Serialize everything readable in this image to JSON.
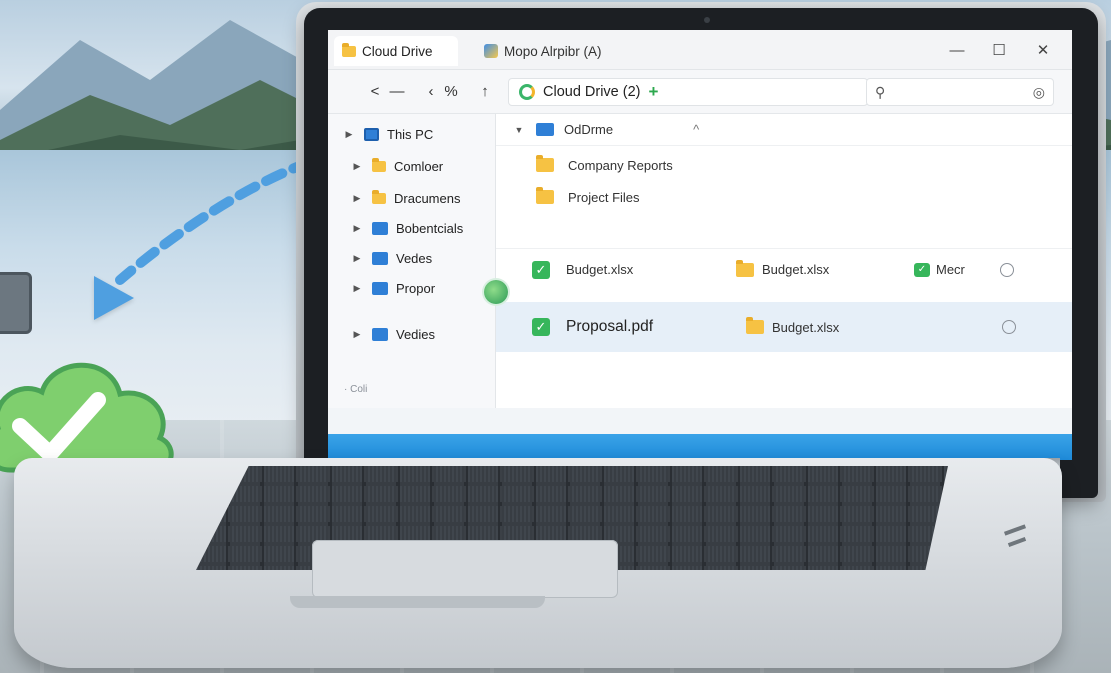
{
  "window": {
    "tabs": [
      {
        "label": "Cloud Drive"
      },
      {
        "label": "Mopo Alrpibr (A)"
      }
    ],
    "controls": {
      "minimize": "—",
      "maximize": "☐",
      "close": "✕"
    }
  },
  "toolbar": {
    "back": "<",
    "dash": "—",
    "nav_a": "‹",
    "nav_b": "%",
    "up": "↑",
    "address": "Cloud Drive (2)",
    "address_add": "+",
    "search_icon": "⚲",
    "search_option": "◎"
  },
  "sidebar": {
    "items": [
      {
        "label": "This PC",
        "icon": "pc-icon"
      },
      {
        "label": "Comloer",
        "icon": "folder-icon"
      },
      {
        "label": "Dracumens",
        "icon": "folder-icon"
      },
      {
        "label": "Bobentcials",
        "icon": "folder-icon"
      },
      {
        "label": "Vedes",
        "icon": "folder-icon"
      },
      {
        "label": "Propor",
        "icon": "folder-icon"
      },
      {
        "label": "Vedies",
        "icon": "folder-icon"
      }
    ],
    "footer": "· Coli"
  },
  "content": {
    "header": {
      "label": "OdDrme",
      "sort": "^"
    },
    "rows": [
      {
        "name": "Company Reports",
        "icon": "folder-icon"
      },
      {
        "name": "Project Files",
        "icon": "folder-icon"
      },
      {
        "name": "Budget.xlsx",
        "icon": "check-icon",
        "col2": "Budget.xlsx",
        "col3": "Mecr"
      },
      {
        "name": "Proposal.pdf",
        "icon": "check-icon",
        "col2": "Budget.xlsx"
      }
    ]
  },
  "colors": {
    "accent": "#1e8ad8",
    "sync": "#37b65b",
    "folder": "#f6c243"
  }
}
